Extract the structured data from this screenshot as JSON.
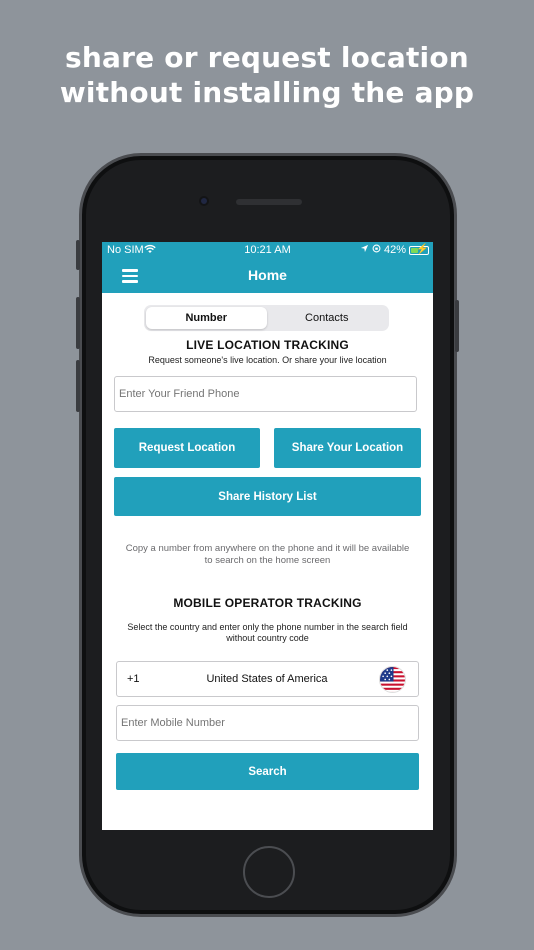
{
  "headline": {
    "line1": "share or request location",
    "line2": "without installing the app"
  },
  "status_bar": {
    "carrier": "No SIM",
    "time": "10:21 AM",
    "battery": "42%"
  },
  "nav": {
    "title": "Home",
    "menu_icon": "hamburger-menu-icon"
  },
  "segmented_control": {
    "tabs": [
      {
        "label": "Number",
        "selected": true
      },
      {
        "label": "Contacts",
        "selected": false
      }
    ]
  },
  "live_tracking": {
    "title": "LIVE LOCATION TRACKING",
    "subtitle": "Request someone's live location. Or share your live location",
    "phone_placeholder": "Enter Your Friend Phone",
    "request_button": "Request Location",
    "share_button": "Share Your Location",
    "history_button": "Share History List"
  },
  "hint": "Copy a number from anywhere on the phone and it will be available to search on the home screen",
  "operator_tracking": {
    "title": "MOBILE OPERATOR TRACKING",
    "subtitle": "Select the country and enter only the phone number in the search field without country code",
    "country_code": "+1",
    "country_name": "United States of America",
    "flag_icon": "us-flag-icon",
    "number_placeholder": "Enter Mobile Number",
    "search_button": "Search"
  },
  "colors": {
    "accent": "#21a0bb",
    "background": "#8e949b"
  }
}
